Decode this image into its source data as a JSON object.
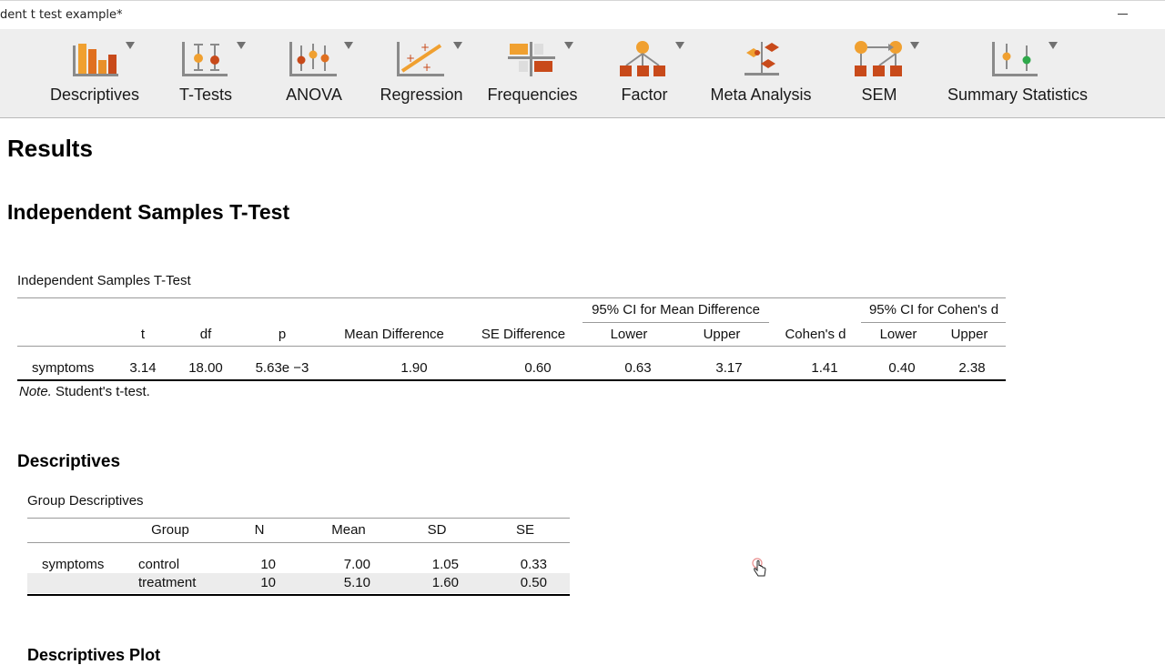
{
  "window": {
    "title": "dent t test example*"
  },
  "ribbon": {
    "items": [
      {
        "label": "Descriptives",
        "icon": "descriptives-icon"
      },
      {
        "label": "T-Tests",
        "icon": "t-tests-icon"
      },
      {
        "label": "ANOVA",
        "icon": "anova-icon"
      },
      {
        "label": "Regression",
        "icon": "regression-icon"
      },
      {
        "label": "Frequencies",
        "icon": "frequencies-icon"
      },
      {
        "label": "Factor",
        "icon": "factor-icon"
      },
      {
        "label": "Meta Analysis",
        "icon": "meta-analysis-icon"
      },
      {
        "label": "SEM",
        "icon": "sem-icon"
      },
      {
        "label": "Summary Statistics",
        "icon": "summary-statistics-icon"
      }
    ]
  },
  "colors": {
    "accent_orange": "#f0a030",
    "accent_red": "#c84a1a",
    "icon_gray": "#8a8a8a",
    "icon_green": "#2ea84a"
  },
  "results": {
    "title": "Results",
    "analysis_title": "Independent Samples T-Test",
    "ttest": {
      "caption": "Independent Samples T-Test",
      "group_headers": {
        "ci_mean": "95% CI for Mean Difference",
        "ci_d": "95% CI for Cohen's d"
      },
      "headers": [
        "",
        "t",
        "df",
        "p",
        "Mean Difference",
        "SE Difference",
        "Lower",
        "Upper",
        "Cohen's d",
        "Lower",
        "Upper"
      ],
      "row": [
        "symptoms",
        "3.14",
        "18.00",
        "5.63e −3",
        "1.90",
        "0.60",
        "0.63",
        "3.17",
        "1.41",
        "0.40",
        "2.38"
      ],
      "note_label": "Note.",
      "note_text": " Student's t-test."
    },
    "descriptives": {
      "title": "Descriptives",
      "caption": "Group Descriptives",
      "headers": [
        "",
        "Group",
        "N",
        "Mean",
        "SD",
        "SE"
      ],
      "rows": [
        [
          "symptoms",
          "control",
          "10",
          "7.00",
          "1.05",
          "0.33"
        ],
        [
          "",
          "treatment",
          "10",
          "5.10",
          "1.60",
          "0.50"
        ]
      ]
    },
    "next_section": "Descriptives Plot"
  }
}
